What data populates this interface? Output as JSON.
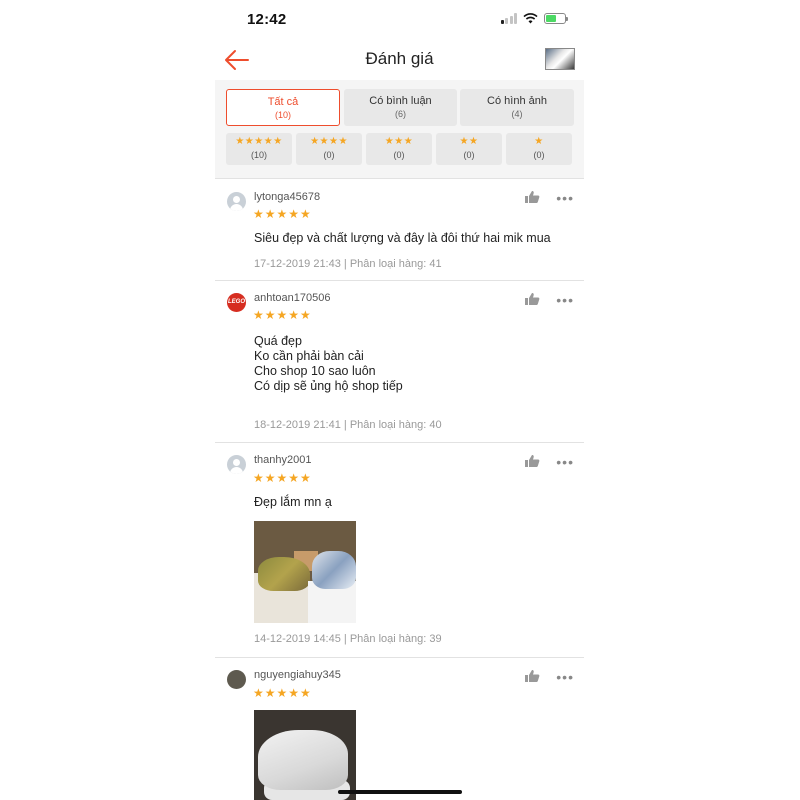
{
  "status_bar": {
    "time": "12:42"
  },
  "header": {
    "title": "Đánh giá",
    "back_icon": "back-arrow-icon"
  },
  "colors": {
    "accent": "#ee4d2d",
    "star": "#f5a623"
  },
  "tabs": [
    {
      "label": "Tất cả",
      "count": "(10)",
      "active": true
    },
    {
      "label": "Có bình luận",
      "count": "(6)",
      "active": false
    },
    {
      "label": "Có hình ảnh",
      "count": "(4)",
      "active": false
    }
  ],
  "star_filters": [
    {
      "stars": "★★★★★",
      "count": "(10)"
    },
    {
      "stars": "★★★★",
      "count": "(0)"
    },
    {
      "stars": "★★★",
      "count": "(0)"
    },
    {
      "stars": "★★",
      "count": "(0)"
    },
    {
      "stars": "★",
      "count": "(0)"
    }
  ],
  "reviews": [
    {
      "username": "lytonga45678",
      "stars": "★★★★★",
      "comment": "Siêu đẹp và chất lượng và đây là đôi thứ hai mik mua",
      "meta": "17-12-2019 21:43 | Phân loại hàng: 41"
    },
    {
      "username": "anhtoan170506",
      "avatar_text": "LEGO",
      "stars": "★★★★★",
      "comment": "Quá đẹp\nKo cần phải bàn cải\nCho shop 10 sao luôn\nCó dịp sẽ ủng hộ shop tiếp",
      "meta": "18-12-2019 21:41 | Phân loại hàng: 40"
    },
    {
      "username": "thanhy2001",
      "stars": "★★★★★",
      "comment": "Đẹp lắm mn ạ",
      "meta": "14-12-2019 14:45 | Phân loại hàng: 39"
    },
    {
      "username": "nguyengiahuy345",
      "stars": "★★★★★"
    }
  ]
}
